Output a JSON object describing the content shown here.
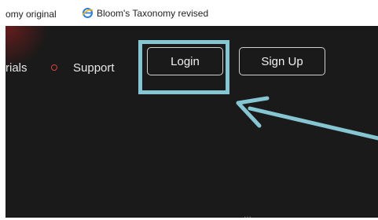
{
  "favorites_bar": {
    "item_1_label": "omy original",
    "item_2_label": "Bloom's Taxonomy revised"
  },
  "nav": {
    "tutorials_label": "rials",
    "support_label": "Support",
    "login_label": "Login",
    "signup_label": "Sign Up"
  },
  "colors": {
    "site_background": "#1a1a1a",
    "annotation": "#86c6d3",
    "nav_separator_dot": "#d9423a"
  },
  "footer_fragment": "..."
}
